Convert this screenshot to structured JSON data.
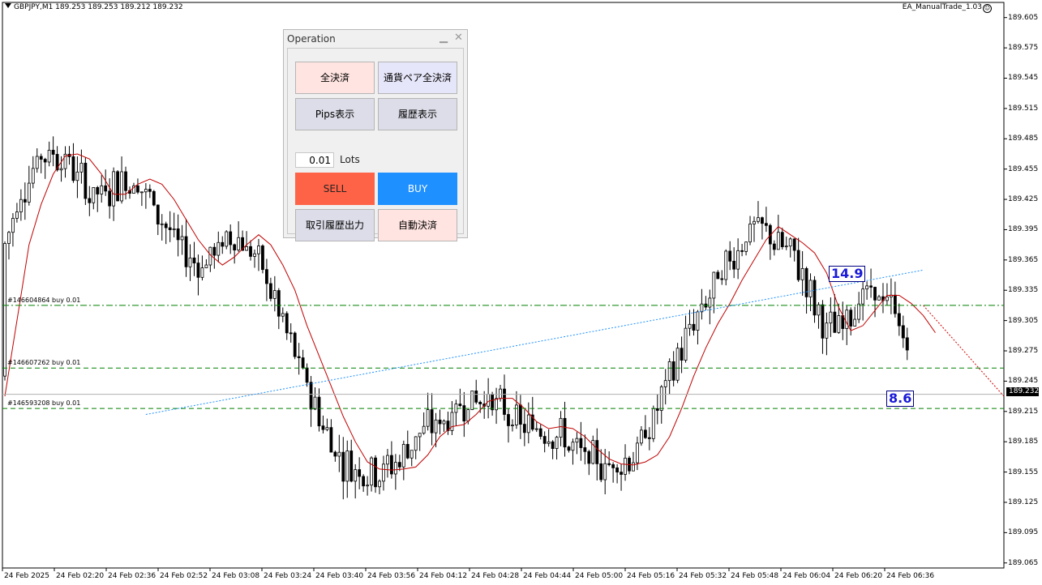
{
  "header": {
    "symbol_info": "GBPJPY,M1  189.253 189.253 189.212 189.232",
    "ea_name": "EA_ManualTrade_1.03",
    "ea_icon": "smiley-icon"
  },
  "price_axis": {
    "labels": [
      "189.605",
      "189.575",
      "189.545",
      "189.515",
      "189.485",
      "189.455",
      "189.425",
      "189.395",
      "189.365",
      "189.335",
      "189.305",
      "189.275",
      "189.245",
      "189.215",
      "189.185",
      "189.155",
      "189.125",
      "189.095",
      "189.065"
    ],
    "current_bid": "189.232"
  },
  "time_axis": {
    "labels": [
      "24 Feb 2025",
      "24 Feb 02:20",
      "24 Feb 02:36",
      "24 Feb 02:52",
      "24 Feb 03:08",
      "24 Feb 03:24",
      "24 Feb 03:40",
      "24 Feb 03:56",
      "24 Feb 04:12",
      "24 Feb 04:28",
      "24 Feb 04:44",
      "24 Feb 05:00",
      "24 Feb 05:16",
      "24 Feb 05:32",
      "24 Feb 05:48",
      "24 Feb 06:04",
      "24 Feb 06:20",
      "24 Feb 06:36"
    ]
  },
  "orders": [
    {
      "label": "#146604864 buy 0.01",
      "price": 189.32
    },
    {
      "label": "#146607262 buy 0.01",
      "price": 189.258
    },
    {
      "label": "#146593208 buy 0.01",
      "price": 189.218
    }
  ],
  "pips": {
    "first": "14.9",
    "second": "8.6"
  },
  "panel": {
    "title": "Operation",
    "minimize_icon": "minimize-icon",
    "close_icon": "close-icon",
    "close_all": "全決済",
    "close_pair": "通貨ペア全決済",
    "pips_display": "Pips表示",
    "history_display": "履歴表示",
    "lots_value": "0.01",
    "lots_label": "Lots",
    "sell": "SELL",
    "buy": "BUY",
    "export_history": "取引履歴出力",
    "auto_close": "自動決済"
  },
  "colors": {
    "sell": "#ff6347",
    "buy": "#1e90ff",
    "close_bg": "#ffe4e1",
    "pair_bg": "#e6e6fa",
    "neutral_bg": "#dcdde8",
    "ma": "#c00000",
    "order_line": "#008000",
    "pips_text": "#1a1ad8"
  },
  "chart_data": {
    "type": "candlestick",
    "ylim": [
      189.06,
      189.62
    ],
    "ma_color": "#c00000",
    "ma": [
      [
        0,
        189.23
      ],
      [
        2,
        189.28
      ],
      [
        4,
        189.33
      ],
      [
        6,
        189.38
      ],
      [
        9,
        189.42
      ],
      [
        12,
        189.45
      ],
      [
        15,
        189.468
      ],
      [
        18,
        189.47
      ],
      [
        21,
        189.465
      ],
      [
        24,
        189.45
      ],
      [
        27,
        189.43
      ],
      [
        30,
        189.43
      ],
      [
        33,
        189.44
      ],
      [
        36,
        189.445
      ],
      [
        39,
        189.44
      ],
      [
        42,
        189.425
      ],
      [
        45,
        189.405
      ],
      [
        48,
        189.385
      ],
      [
        51,
        189.37
      ],
      [
        54,
        189.36
      ],
      [
        57,
        189.368
      ],
      [
        60,
        189.38
      ],
      [
        63,
        189.39
      ],
      [
        66,
        189.38
      ],
      [
        69,
        189.36
      ],
      [
        72,
        189.335
      ],
      [
        75,
        189.3
      ],
      [
        78,
        189.27
      ],
      [
        81,
        189.24
      ],
      [
        84,
        189.21
      ],
      [
        87,
        189.185
      ],
      [
        90,
        189.165
      ],
      [
        93,
        189.158
      ],
      [
        96,
        189.157
      ],
      [
        99,
        189.158
      ],
      [
        102,
        189.16
      ],
      [
        105,
        189.172
      ],
      [
        108,
        189.19
      ],
      [
        111,
        189.2
      ],
      [
        114,
        189.202
      ],
      [
        117,
        189.212
      ],
      [
        120,
        189.225
      ],
      [
        123,
        189.228
      ],
      [
        126,
        189.228
      ],
      [
        129,
        189.218
      ],
      [
        132,
        189.205
      ],
      [
        135,
        189.198
      ],
      [
        138,
        189.2
      ],
      [
        141,
        189.198
      ],
      [
        144,
        189.19
      ],
      [
        147,
        189.178
      ],
      [
        150,
        189.168
      ],
      [
        153,
        189.163
      ],
      [
        156,
        189.162
      ],
      [
        159,
        189.165
      ],
      [
        162,
        189.172
      ],
      [
        165,
        189.19
      ],
      [
        168,
        189.218
      ],
      [
        171,
        189.25
      ],
      [
        174,
        189.278
      ],
      [
        177,
        189.302
      ],
      [
        180,
        189.322
      ],
      [
        183,
        189.345
      ],
      [
        186,
        189.365
      ],
      [
        189,
        189.385
      ],
      [
        192,
        189.398
      ],
      [
        195,
        189.39
      ],
      [
        198,
        189.382
      ],
      [
        201,
        189.372
      ],
      [
        204,
        189.352
      ],
      [
        207,
        189.318
      ],
      [
        210,
        189.295
      ],
      [
        213,
        189.3
      ],
      [
        216,
        189.315
      ],
      [
        219,
        189.33
      ],
      [
        222,
        189.33
      ],
      [
        225,
        189.322
      ],
      [
        228,
        189.31
      ],
      [
        231,
        189.293
      ]
    ],
    "candles_note": "OHLC series depicted; values estimated visually",
    "buy_arrow_from": [
      35,
      189.212
    ],
    "buy_arrow_to": [
      228,
      189.355
    ],
    "sell_arrow_from": [
      228,
      189.32
    ],
    "sell_arrow_to": [
      248,
      189.23
    ]
  }
}
